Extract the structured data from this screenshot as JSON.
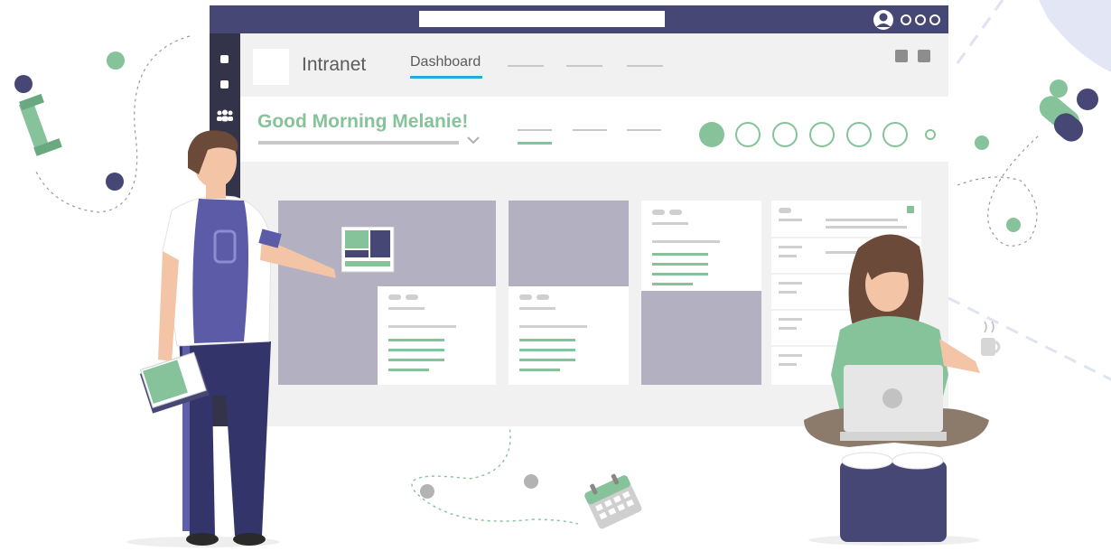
{
  "app": {
    "brand": "Intranet",
    "tabs": [
      {
        "label": "Dashboard",
        "active": true
      }
    ],
    "greeting": "Good Morning Melanie!",
    "pagination": {
      "total": 7,
      "active_index": 0
    }
  },
  "icons": {
    "user": "user-avatar-icon",
    "more": "more-dots-icon",
    "people": "people-icon",
    "chevron": "chevron-down-icon",
    "calendar": "calendar-icon",
    "pushpin": "pushpin-icon",
    "laptop": "laptop-icon",
    "book": "book-icon",
    "mug": "coffee-mug-icon"
  },
  "colors": {
    "titlebar": "#464775",
    "rail": "#33344a",
    "accent_green": "#86c29a",
    "tab_underline": "#29a8e0",
    "card_image": "#b3b0c2",
    "dark_purple": "#464775"
  }
}
